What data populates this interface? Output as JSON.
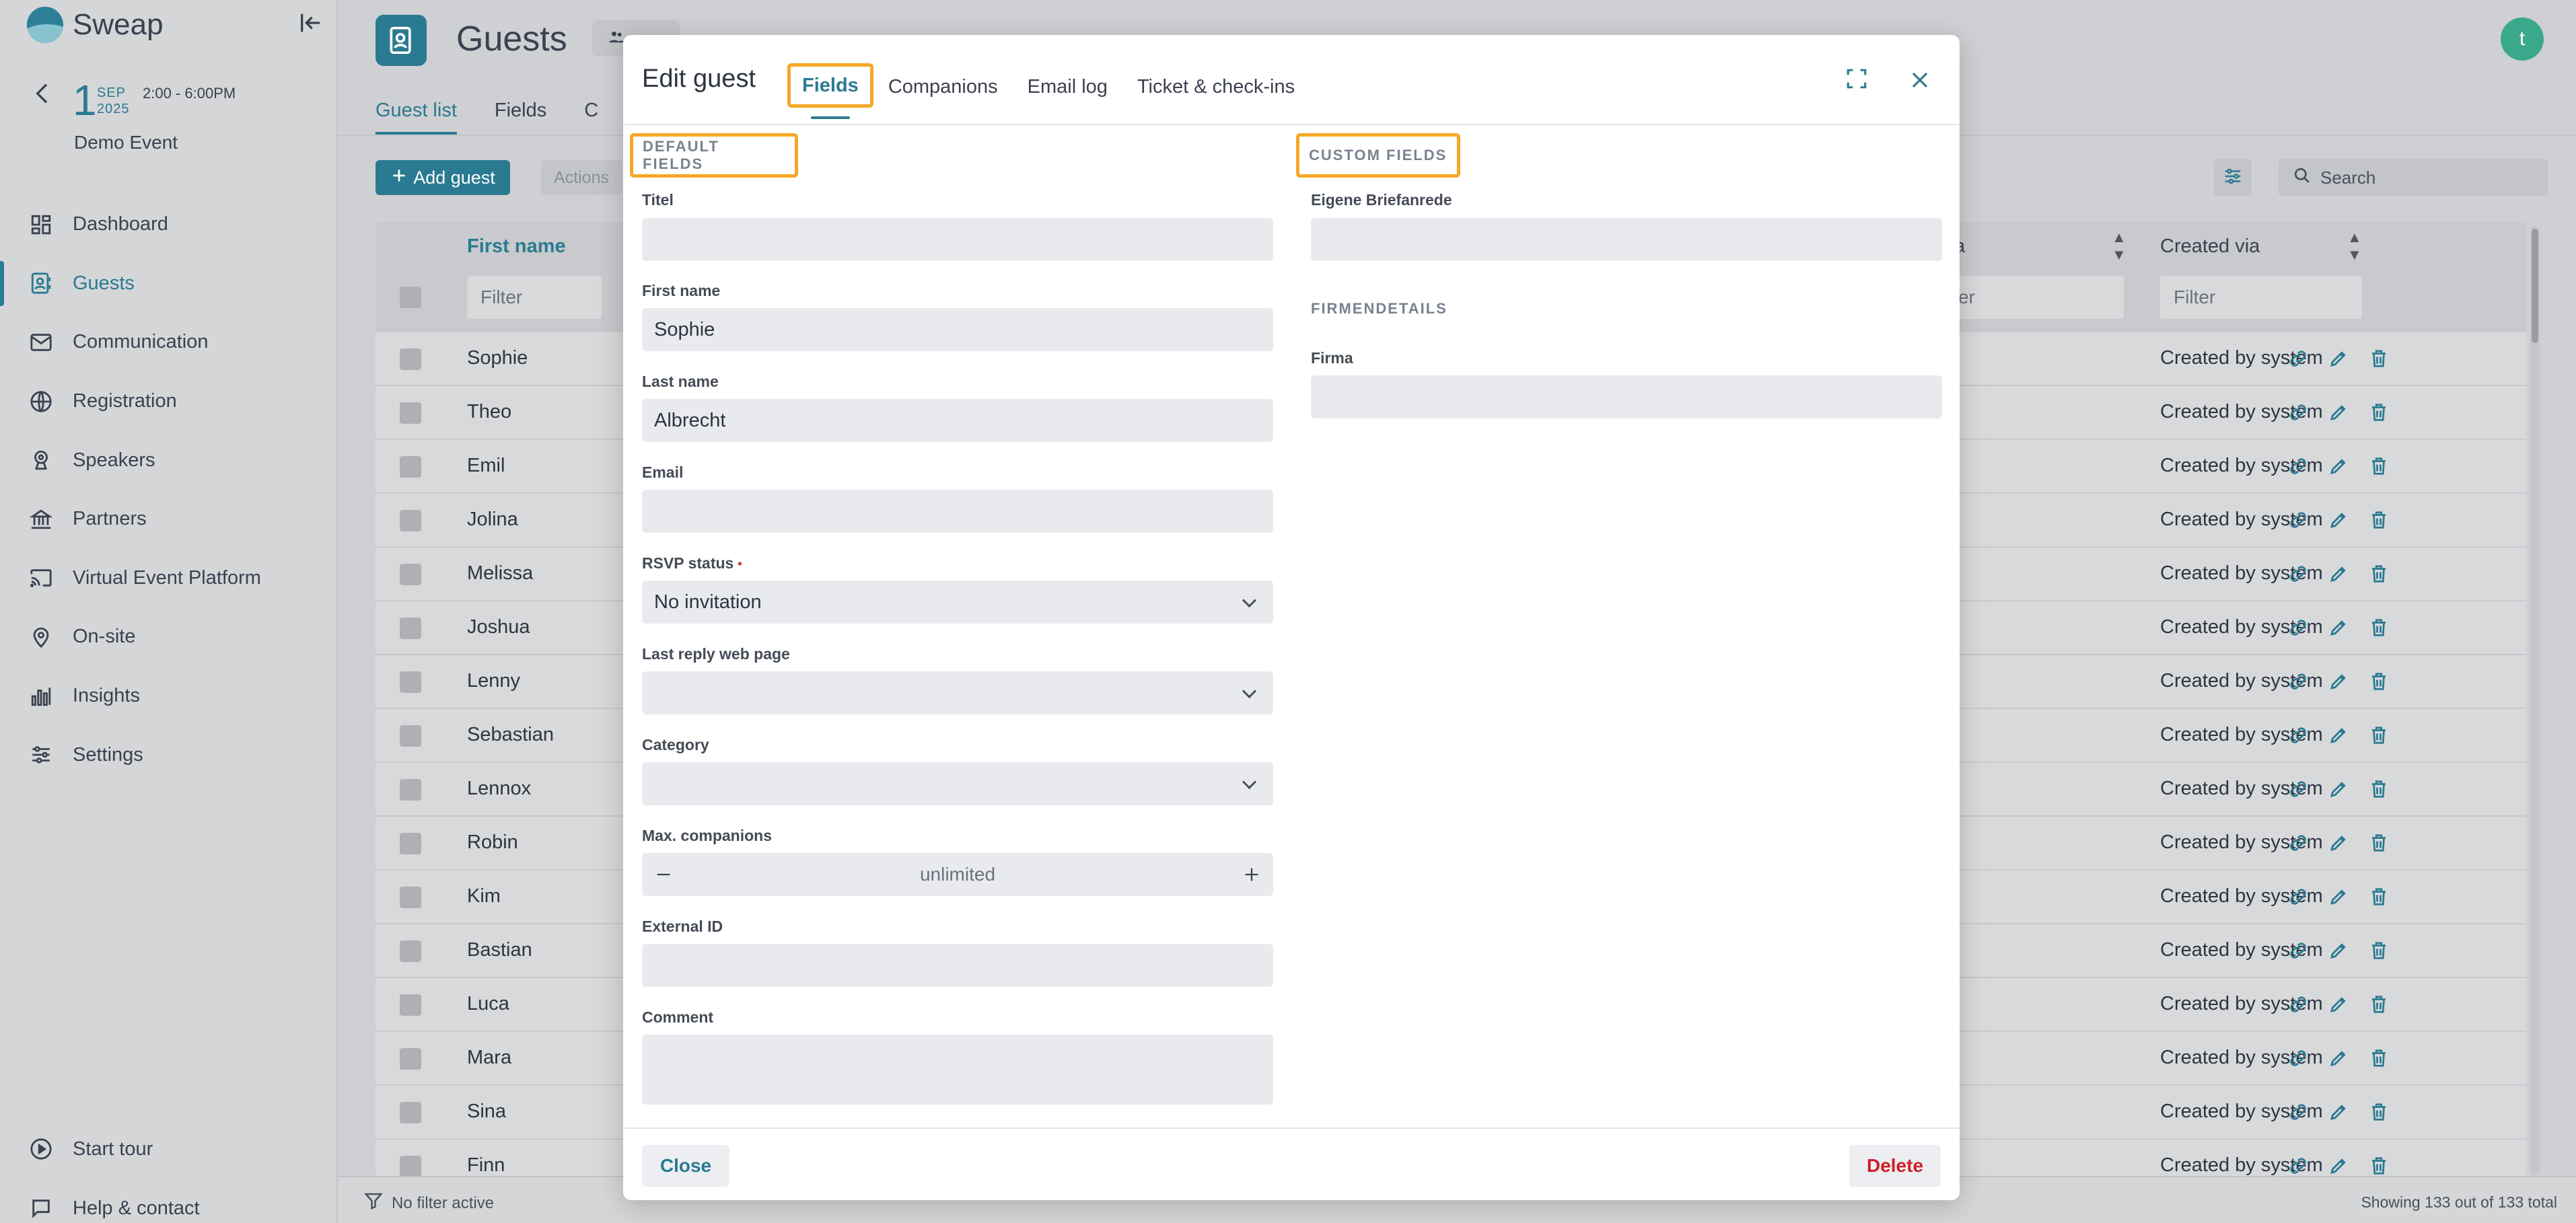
{
  "app": {
    "name": "Sweap"
  },
  "event": {
    "day": "1",
    "month": "SEP",
    "year": "2025",
    "time": "2:00 - 6:00PM",
    "name": "Demo Event"
  },
  "sidebar": {
    "items": [
      {
        "label": "Dashboard",
        "icon": "dashboard-icon"
      },
      {
        "label": "Guests",
        "icon": "guests-icon",
        "active": true
      },
      {
        "label": "Communication",
        "icon": "mail-icon"
      },
      {
        "label": "Registration",
        "icon": "globe-icon"
      },
      {
        "label": "Speakers",
        "icon": "speaker-icon"
      },
      {
        "label": "Partners",
        "icon": "bank-icon"
      },
      {
        "label": "Virtual Event Platform",
        "icon": "cast-icon"
      },
      {
        "label": "On-site",
        "icon": "location-pin-icon"
      },
      {
        "label": "Insights",
        "icon": "bar-chart-icon"
      },
      {
        "label": "Settings",
        "icon": "sliders-icon"
      }
    ],
    "bottom": [
      {
        "label": "Start tour",
        "icon": "play-icon"
      },
      {
        "label": "Help & contact",
        "icon": "chat-icon"
      }
    ]
  },
  "header": {
    "title": "Guests",
    "avatar_initial": "t"
  },
  "page_tabs": [
    "Guest list",
    "Fields",
    "C"
  ],
  "toolbar": {
    "add_guest": "Add guest",
    "actions": "Actions",
    "search_placeholder": "Search"
  },
  "table": {
    "columns": {
      "first_name": "First name",
      "partial_col": "a",
      "created_via": "Created via"
    },
    "filter_placeholder": "Filter",
    "filter_partial": "er",
    "rows": [
      {
        "first_name": "Sophie",
        "created_via": "Created by system"
      },
      {
        "first_name": "Theo",
        "created_via": "Created by system"
      },
      {
        "first_name": "Emil",
        "created_via": "Created by system"
      },
      {
        "first_name": "Jolina",
        "created_via": "Created by system"
      },
      {
        "first_name": "Melissa",
        "created_via": "Created by system"
      },
      {
        "first_name": "Joshua",
        "created_via": "Created by system"
      },
      {
        "first_name": "Lenny",
        "created_via": "Created by system"
      },
      {
        "first_name": "Sebastian",
        "created_via": "Created by system"
      },
      {
        "first_name": "Lennox",
        "created_via": "Created by system"
      },
      {
        "first_name": "Robin",
        "created_via": "Created by system"
      },
      {
        "first_name": "Kim",
        "created_via": "Created by system"
      },
      {
        "first_name": "Bastian",
        "created_via": "Created by system"
      },
      {
        "first_name": "Luca",
        "created_via": "Created by system"
      },
      {
        "first_name": "Mara",
        "created_via": "Created by system"
      },
      {
        "first_name": "Sina",
        "created_via": "Created by system"
      },
      {
        "first_name": "Finn",
        "created_via": "Created by system"
      }
    ]
  },
  "footer": {
    "filter_status": "No filter active",
    "showing": "Showing 133 out of 133 total"
  },
  "modal": {
    "title": "Edit guest",
    "tabs": [
      "Fields",
      "Companions",
      "Email log",
      "Ticket & check-ins"
    ],
    "active_tab": "Fields",
    "default_fields_heading": "DEFAULT FIELDS",
    "custom_fields_heading": "CUSTOM FIELDS",
    "fields": {
      "titel": {
        "label": "Titel",
        "value": ""
      },
      "first_name": {
        "label": "First name",
        "value": "Sophie"
      },
      "last_name": {
        "label": "Last name",
        "value": "Albrecht"
      },
      "email": {
        "label": "Email",
        "value": ""
      },
      "rsvp_status": {
        "label": "RSVP status",
        "required_mark": "•",
        "value": "No invitation"
      },
      "last_reply_web_page": {
        "label": "Last reply web page",
        "value": ""
      },
      "category": {
        "label": "Category",
        "value": ""
      },
      "max_companions": {
        "label": "Max. companions",
        "value": "unlimited"
      },
      "external_id": {
        "label": "External ID",
        "value": ""
      },
      "comment": {
        "label": "Comment",
        "value": ""
      }
    },
    "custom": {
      "eigene_briefanrede": {
        "label": "Eigene Briefanrede",
        "value": ""
      },
      "firmendetails_heading": "FIRMENDETAILS",
      "firma": {
        "label": "Firma",
        "value": ""
      }
    },
    "buttons": {
      "close": "Close",
      "delete": "Delete"
    }
  },
  "colors": {
    "accent": "#2a7a91",
    "highlight": "#f6a826",
    "danger": "#d01f2a",
    "avatar": "#3aa88b"
  }
}
